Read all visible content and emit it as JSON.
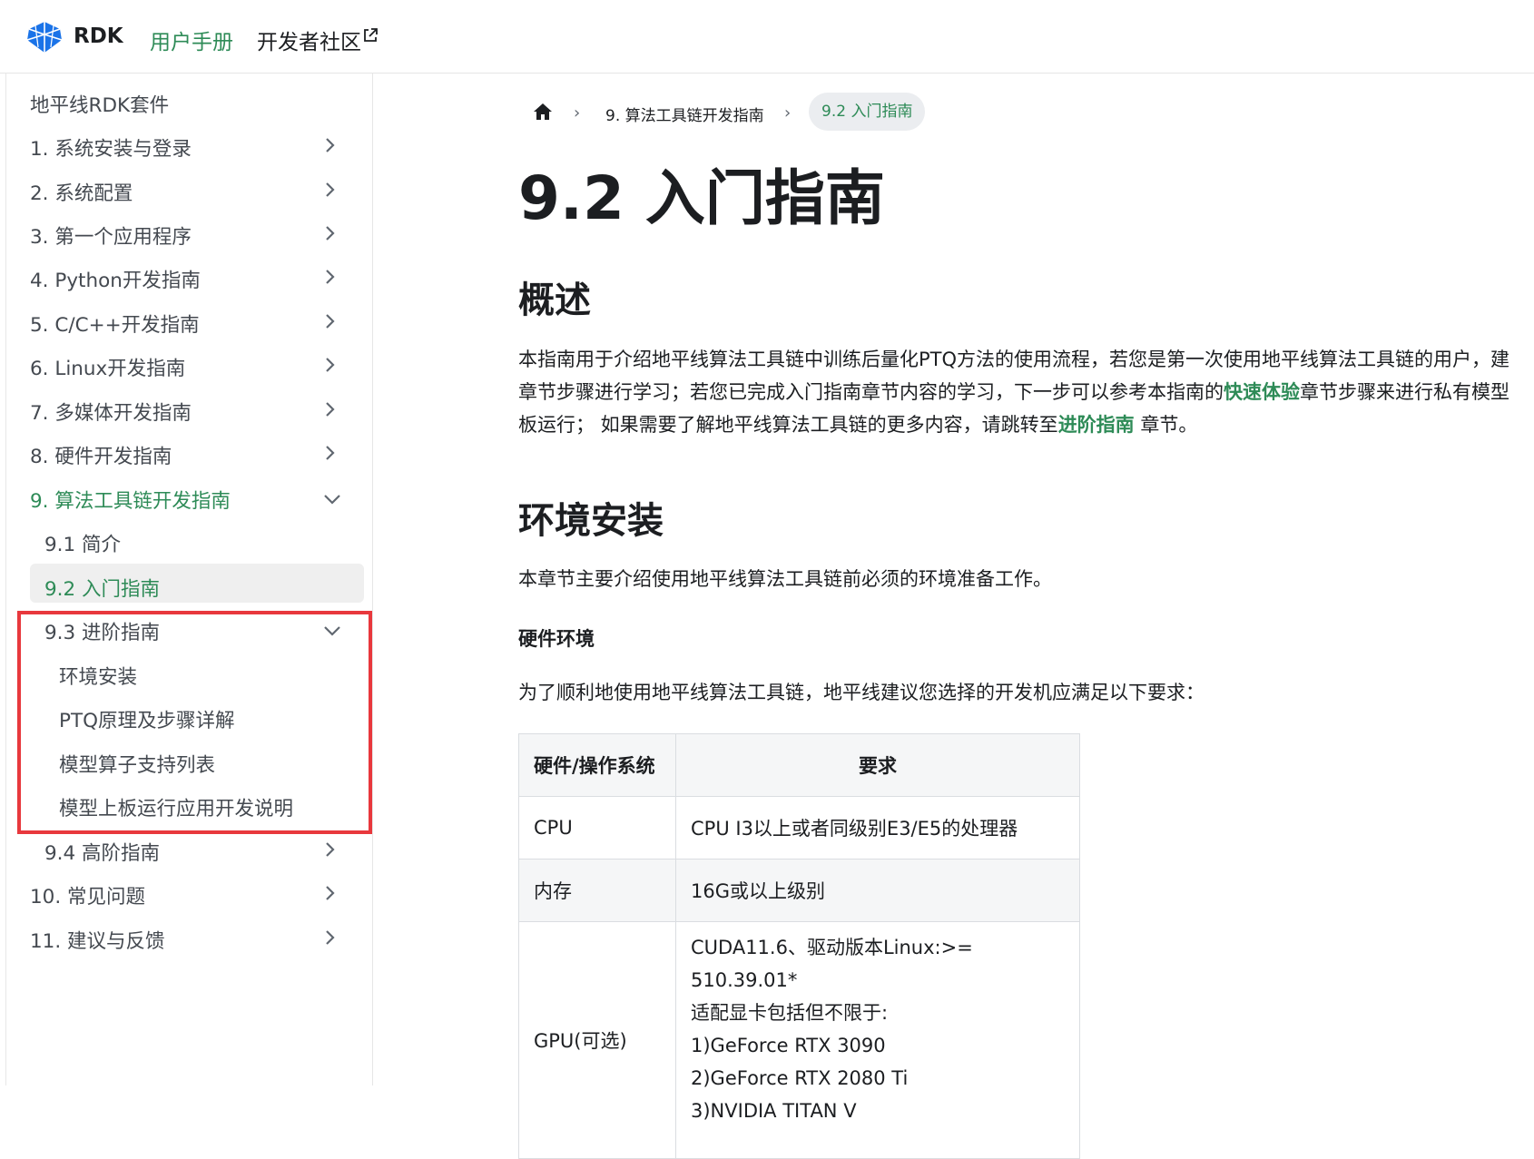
{
  "navbar": {
    "logo_text": "RDK",
    "links": [
      {
        "label": "用户手册",
        "active": true
      },
      {
        "label": "开发者社区",
        "external": true
      }
    ]
  },
  "sidebar": {
    "items": [
      {
        "label": "地平线RDK套件",
        "level": 0
      },
      {
        "label": "1. 系统安装与登录",
        "level": 0,
        "chevron": "right"
      },
      {
        "label": "2. 系统配置",
        "level": 0,
        "chevron": "right"
      },
      {
        "label": "3. 第一个应用程序",
        "level": 0,
        "chevron": "right"
      },
      {
        "label": "4. Python开发指南",
        "level": 0,
        "chevron": "right"
      },
      {
        "label": "5. C/C++开发指南",
        "level": 0,
        "chevron": "right"
      },
      {
        "label": "6. Linux开发指南",
        "level": 0,
        "chevron": "right"
      },
      {
        "label": "7. 多媒体开发指南",
        "level": 0,
        "chevron": "right"
      },
      {
        "label": "8. 硬件开发指南",
        "level": 0,
        "chevron": "right"
      },
      {
        "label": "9. 算法工具链开发指南",
        "level": 0,
        "chevron": "down",
        "active": true
      },
      {
        "label": "9.1 简介",
        "level": 1
      },
      {
        "label": "9.2 入门指南",
        "level": 1,
        "active": true,
        "selected": true
      },
      {
        "label": "9.3 进阶指南",
        "level": 1,
        "chevron": "down"
      },
      {
        "label": "环境安装",
        "level": 2
      },
      {
        "label": "PTQ原理及步骤详解",
        "level": 2
      },
      {
        "label": "模型算子支持列表",
        "level": 2
      },
      {
        "label": "模型上板运行应用开发说明",
        "level": 2
      },
      {
        "label": "9.4 高阶指南",
        "level": 1,
        "chevron": "right"
      },
      {
        "label": "10. 常见问题",
        "level": 0,
        "chevron": "right"
      },
      {
        "label": "11. 建议与反馈",
        "level": 0,
        "chevron": "right"
      }
    ],
    "highlight_color": "#e8383d"
  },
  "breadcrumb": {
    "home_icon": "home-icon",
    "items": [
      "9. 算法工具链开发指南",
      "9.2 入门指南"
    ]
  },
  "content": {
    "title": "9.2 入门指南",
    "overview_heading": "概述",
    "overview_lines": [
      {
        "pre": "本指南用于介绍地平线算法工具链中训练后量化PTQ方法的使用流程，若您是第一次使用地平线算法工具链的用户，建",
        "link": "",
        "post": ""
      },
      {
        "pre": "章节步骤进行学习；若您已完成入门指南章节内容的学习，下一步可以参考本指南的",
        "link": "快速体验",
        "post": "章节步骤来进行私有模型"
      },
      {
        "pre": "板运行； 如果需要了解地平线算法工具链的更多内容，请跳转至",
        "link": "进阶指南",
        "post": " 章节。"
      }
    ],
    "env_heading": "环境安装",
    "env_intro": "本章节主要介绍使用地平线算法工具链前必须的环境准备工作。",
    "hw_heading": "硬件环境",
    "hw_intro": "为了顺利地使用地平线算法工具链，地平线建议您选择的开发机应满足以下要求：",
    "table": {
      "headers": [
        "硬件/操作系统",
        "要求"
      ],
      "rows": [
        {
          "name": "CPU",
          "req": "CPU I3以上或者同级别E3/E5的处理器"
        },
        {
          "name": "内存",
          "req": "16G或以上级别"
        },
        {
          "name": "GPU(可选)",
          "req_lines": [
            "CUDA11.6、驱动版本Linux:>= 510.39.01*",
            "适配显卡包括但不限于:",
            "1)GeForce RTX 3090",
            "2)GeForce RTX 2080 Ti",
            "3)NVIDIA TITAN V"
          ]
        }
      ]
    }
  },
  "colors": {
    "accent": "#2e8b57",
    "logo": "#1a73e8"
  }
}
